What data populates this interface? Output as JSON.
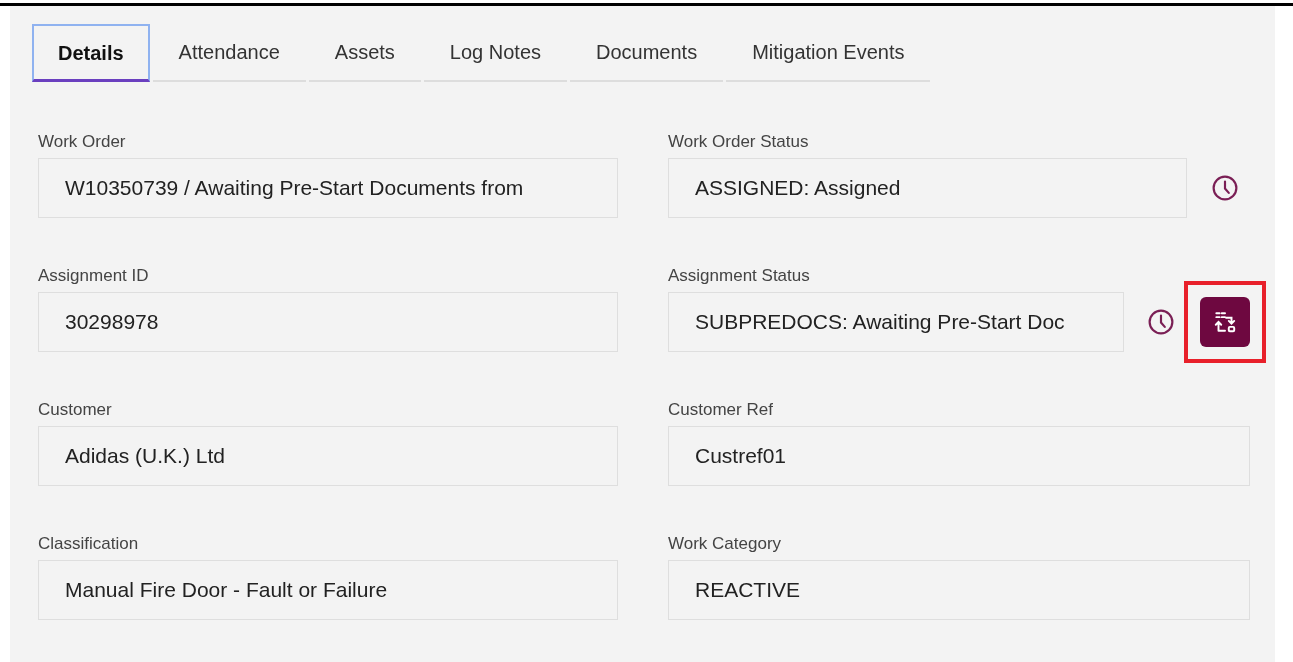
{
  "tabs": [
    {
      "label": "Details",
      "selected": true
    },
    {
      "label": "Attendance",
      "selected": false
    },
    {
      "label": "Assets",
      "selected": false
    },
    {
      "label": "Log Notes",
      "selected": false
    },
    {
      "label": "Documents",
      "selected": false
    },
    {
      "label": "Mitigation Events",
      "selected": false
    }
  ],
  "fields": [
    {
      "label": "Work Order",
      "value": "W10350739 / Awaiting Pre-Start Documents from",
      "kind": "plain"
    },
    {
      "label": "Work Order Status",
      "value": "ASSIGNED: Assigned",
      "kind": "history"
    },
    {
      "label": "Assignment ID",
      "value": "30298978",
      "kind": "plain"
    },
    {
      "label": "Assignment Status",
      "value": "SUBPREDOCS: Awaiting Pre-Start Doc",
      "kind": "history_action",
      "highlighted": true
    },
    {
      "label": "Customer",
      "value": "Adidas (U.K.) Ltd",
      "kind": "plain"
    },
    {
      "label": "Customer Ref",
      "value": "Custref01",
      "kind": "plain"
    },
    {
      "label": "Classification",
      "value": "Manual Fire Door - Fault or Failure",
      "kind": "plain"
    },
    {
      "label": "Work Category",
      "value": "REACTIVE",
      "kind": "plain"
    }
  ]
}
